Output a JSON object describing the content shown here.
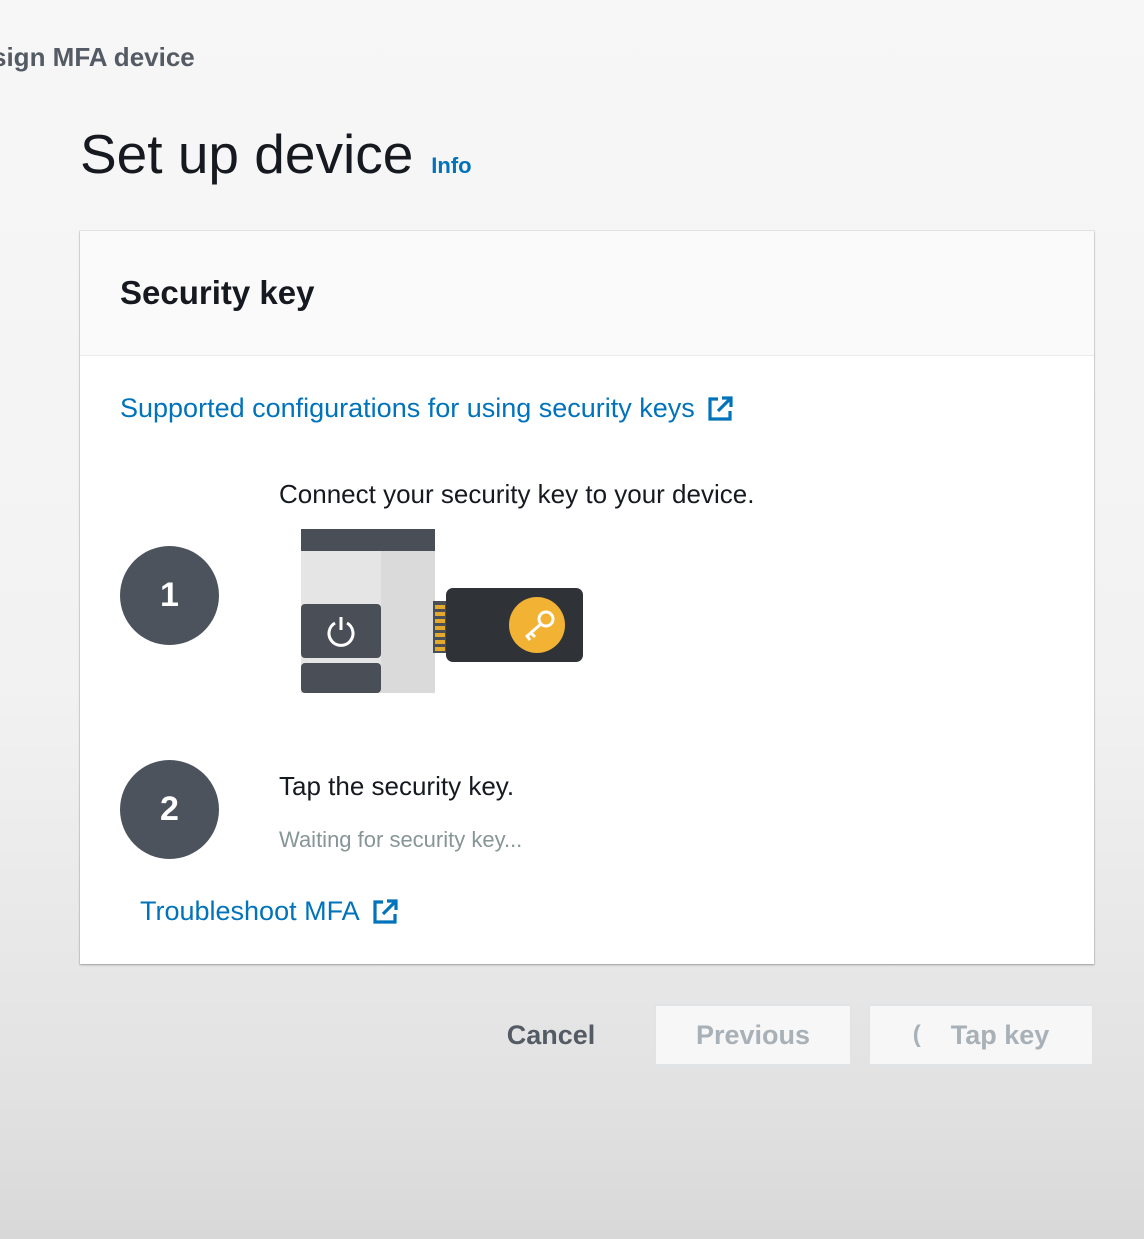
{
  "breadcrumb": {
    "current": "sign MFA device"
  },
  "header": {
    "title": "Set up device",
    "info_label": "Info"
  },
  "card": {
    "title": "Security key",
    "supported_link": "Supported configurations for using security keys",
    "steps": [
      {
        "number": "1",
        "text": "Connect your security key to your device."
      },
      {
        "number": "2",
        "text": "Tap the security key.",
        "status": "Waiting for security key..."
      }
    ],
    "troubleshoot_link": "Troubleshoot MFA"
  },
  "actions": {
    "cancel_label": "Cancel",
    "previous_label": "Previous",
    "tapkey_label": "Tap key",
    "spinner_glyph": "("
  },
  "colors": {
    "link": "#0073bb",
    "step_circle": "#4d535d",
    "security_key_body": "#2f3338",
    "key_badge": "#f2b233"
  },
  "icons": {
    "external_link": "external-link-icon",
    "power": "power-icon",
    "key": "key-icon",
    "spinner": "spinner-icon"
  }
}
